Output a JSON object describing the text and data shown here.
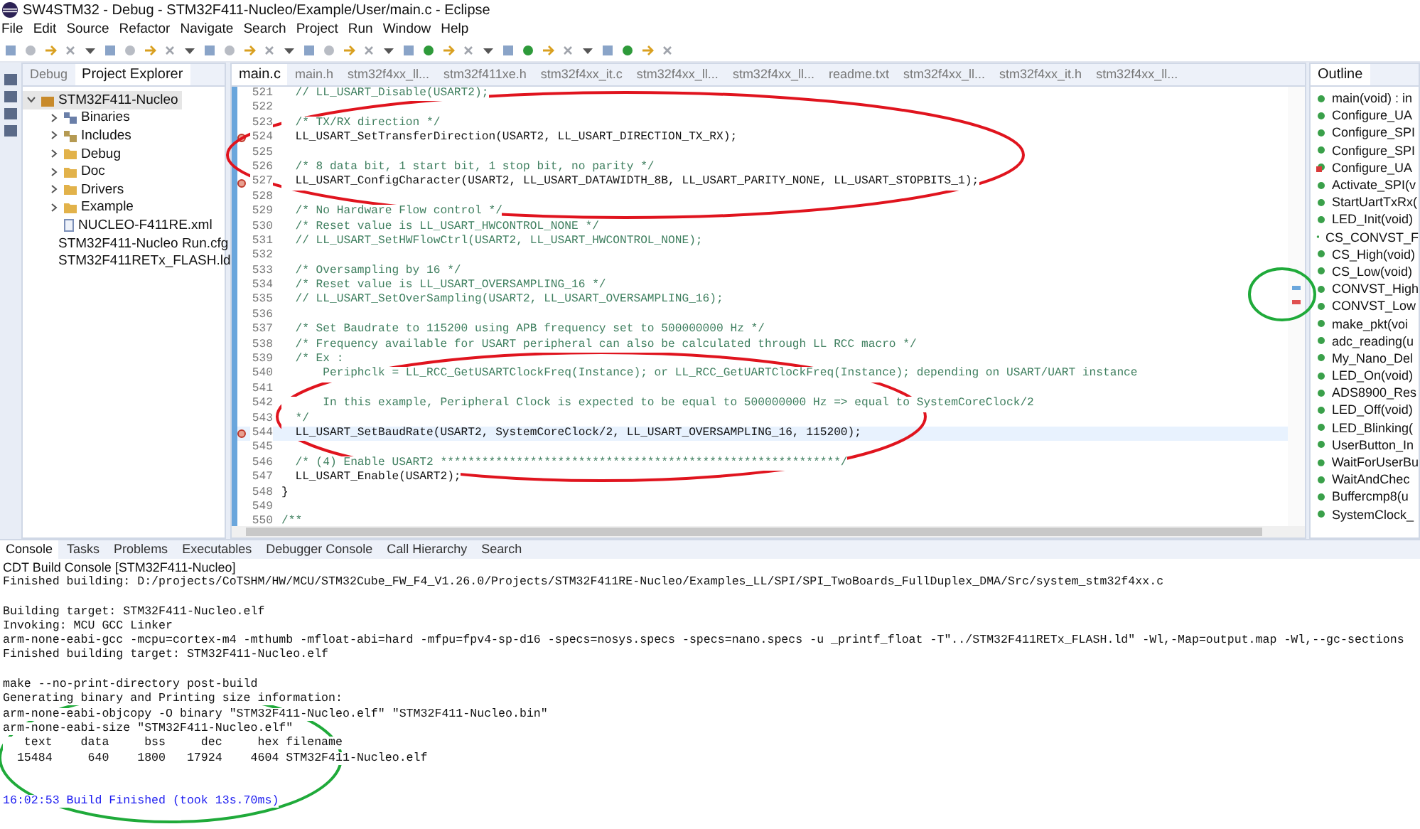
{
  "window": {
    "title": "SW4STM32 - Debug - STM32F411-Nucleo/Example/User/main.c - Eclipse"
  },
  "menu": [
    "File",
    "Edit",
    "Source",
    "Refactor",
    "Navigate",
    "Search",
    "Project",
    "Run",
    "Window",
    "Help"
  ],
  "left_panel": {
    "tabs": [
      {
        "label": "Debug",
        "selected": false
      },
      {
        "label": "Project Explorer",
        "selected": true
      }
    ],
    "tree": [
      {
        "label": "STM32F411-Nucleo",
        "kind": "project",
        "expanded": true,
        "selected": true,
        "children": [
          {
            "label": "Binaries",
            "kind": "binaries",
            "expanded": false,
            "selected": false
          },
          {
            "label": "Includes",
            "kind": "includes",
            "expanded": false,
            "selected": false
          },
          {
            "label": "Debug",
            "kind": "folder",
            "expanded": false,
            "selected": false
          },
          {
            "label": "Doc",
            "kind": "folder",
            "expanded": false,
            "selected": false
          },
          {
            "label": "Drivers",
            "kind": "folder",
            "expanded": false,
            "selected": false
          },
          {
            "label": "Example",
            "kind": "folder",
            "expanded": false,
            "selected": false
          },
          {
            "label": "NUCLEO-F411RE.xml",
            "kind": "file",
            "selected": false
          },
          {
            "label": "STM32F411-Nucleo Run.cfg",
            "kind": "file",
            "selected": false
          },
          {
            "label": "STM32F411RETx_FLASH.ld",
            "kind": "file",
            "selected": false
          }
        ]
      }
    ]
  },
  "editor": {
    "tabs": [
      {
        "label": "main.c",
        "selected": true
      },
      {
        "label": "main.h",
        "selected": false
      },
      {
        "label": "stm32f4xx_ll...",
        "selected": false
      },
      {
        "label": "stm32f411xe.h",
        "selected": false
      },
      {
        "label": "stm32f4xx_it.c",
        "selected": false
      },
      {
        "label": "stm32f4xx_ll...",
        "selected": false
      },
      {
        "label": "stm32f4xx_ll...",
        "selected": false
      },
      {
        "label": "readme.txt",
        "selected": false
      },
      {
        "label": "stm32f4xx_ll...",
        "selected": false
      },
      {
        "label": "stm32f4xx_it.h",
        "selected": false
      },
      {
        "label": "stm32f4xx_ll...",
        "selected": false
      }
    ],
    "lines": [
      {
        "num": "521",
        "text": "  // LL_USART_Disable(USART2);",
        "kind": "comment",
        "current": false,
        "marker": false
      },
      {
        "num": "522",
        "kind": "blank",
        "current": false,
        "marker": false
      },
      {
        "num": "523",
        "text": "  /* TX/RX direction */",
        "kind": "comment",
        "current": false,
        "marker": false
      },
      {
        "num": "524",
        "text": "  LL_USART_SetTransferDirection(USART2, LL_USART_DIRECTION_TX_RX);",
        "kind": "code",
        "current": false,
        "marker": true
      },
      {
        "num": "525",
        "kind": "blank",
        "current": false,
        "marker": false
      },
      {
        "num": "526",
        "text": "  /* 8 data bit, 1 start bit, 1 stop bit, no parity */",
        "kind": "comment",
        "current": false,
        "marker": false
      },
      {
        "num": "527",
        "text": "  LL_USART_ConfigCharacter(USART2, LL_USART_DATAWIDTH_8B, LL_USART_PARITY_NONE, LL_USART_STOPBITS_1);",
        "kind": "code",
        "current": false,
        "marker": true
      },
      {
        "num": "528",
        "kind": "blank",
        "current": false,
        "marker": false
      },
      {
        "num": "529",
        "text": "  /* No Hardware Flow control */",
        "kind": "comment",
        "current": false,
        "marker": false
      },
      {
        "num": "530",
        "text": "  /* Reset value is LL_USART_HWCONTROL_NONE */",
        "kind": "comment",
        "current": false,
        "marker": false
      },
      {
        "num": "531",
        "text": "  // LL_USART_SetHWFlowCtrl(USART2, LL_USART_HWCONTROL_NONE);",
        "kind": "comment",
        "current": false,
        "marker": false
      },
      {
        "num": "532",
        "kind": "blank",
        "current": false,
        "marker": false
      },
      {
        "num": "533",
        "text": "  /* Oversampling by 16 */",
        "kind": "comment",
        "current": false,
        "marker": false
      },
      {
        "num": "534",
        "text": "  /* Reset value is LL_USART_OVERSAMPLING_16 */",
        "kind": "comment",
        "current": false,
        "marker": false
      },
      {
        "num": "535",
        "text": "  // LL_USART_SetOverSampling(USART2, LL_USART_OVERSAMPLING_16);",
        "kind": "comment",
        "current": false,
        "marker": false
      },
      {
        "num": "536",
        "kind": "blank",
        "current": false,
        "marker": false
      },
      {
        "num": "537",
        "text": "  /* Set Baudrate to 115200 using APB frequency set to 500000000 Hz */",
        "kind": "comment",
        "current": false,
        "marker": false
      },
      {
        "num": "538",
        "text": "  /* Frequency available for USART peripheral can also be calculated through LL RCC macro */",
        "kind": "comment",
        "current": false,
        "marker": false
      },
      {
        "num": "539",
        "text": "  /* Ex :",
        "kind": "comment",
        "current": false,
        "marker": false
      },
      {
        "num": "540",
        "text": "      Periphclk = LL_RCC_GetUSARTClockFreq(Instance); or LL_RCC_GetUARTClockFreq(Instance); depending on USART/UART instance",
        "kind": "comment",
        "current": false,
        "marker": false
      },
      {
        "num": "541",
        "kind": "blank",
        "current": false,
        "marker": false
      },
      {
        "num": "542",
        "text": "      In this example, Peripheral Clock is expected to be equal to 500000000 Hz => equal to SystemCoreClock/2",
        "kind": "comment",
        "current": false,
        "marker": false
      },
      {
        "num": "543",
        "text": "  */",
        "kind": "comment",
        "current": false,
        "marker": false
      },
      {
        "num": "544",
        "text": "  LL_USART_SetBaudRate(USART2, SystemCoreClock/2, LL_USART_OVERSAMPLING_16, 115200);",
        "kind": "code",
        "current": true,
        "marker": true
      },
      {
        "num": "545",
        "kind": "blank",
        "current": false,
        "marker": false
      },
      {
        "num": "546",
        "text": "  /* (4) Enable USART2 **********************************************************/",
        "kind": "comment",
        "current": false,
        "marker": false
      },
      {
        "num": "547",
        "text": "  LL_USART_Enable(USART2);",
        "kind": "code",
        "current": false,
        "marker": false
      },
      {
        "num": "548",
        "text": "}",
        "kind": "code",
        "current": false,
        "marker": false
      },
      {
        "num": "549",
        "kind": "blank",
        "current": false,
        "marker": false
      },
      {
        "num": "550",
        "text": "/**",
        "kind": "comment",
        "current": false,
        "marker": false
      }
    ]
  },
  "outline": {
    "tab": "Outline",
    "items": [
      {
        "label": "main(void) : in",
        "kind": "function"
      },
      {
        "label": "Configure_UA",
        "kind": "function"
      },
      {
        "label": "Configure_SPI",
        "kind": "function"
      },
      {
        "label": "Configure_SPI",
        "kind": "function"
      },
      {
        "label": "Configure_UA",
        "kind": "flagged"
      },
      {
        "label": "Activate_SPI(v",
        "kind": "function"
      },
      {
        "label": "StartUartTxRx(",
        "kind": "function"
      },
      {
        "label": "LED_Init(void)",
        "kind": "function"
      },
      {
        "label": "CS_CONVST_F",
        "kind": "function"
      },
      {
        "label": "CS_High(void)",
        "kind": "function"
      },
      {
        "label": "CS_Low(void)",
        "kind": "function"
      },
      {
        "label": "CONVST_High",
        "kind": "function"
      },
      {
        "label": "CONVST_Low",
        "kind": "function"
      },
      {
        "label": "make_pkt(voi",
        "kind": "function"
      },
      {
        "label": "adc_reading(u",
        "kind": "function"
      },
      {
        "label": "My_Nano_Del",
        "kind": "function"
      },
      {
        "label": "LED_On(void)",
        "kind": "function"
      },
      {
        "label": "ADS8900_Res",
        "kind": "function"
      },
      {
        "label": "LED_Off(void)",
        "kind": "function"
      },
      {
        "label": "LED_Blinking(",
        "kind": "function"
      },
      {
        "label": "UserButton_In",
        "kind": "function"
      },
      {
        "label": "WaitForUserBu",
        "kind": "function"
      },
      {
        "label": "WaitAndChec",
        "kind": "function"
      },
      {
        "label": "Buffercmp8(u",
        "kind": "function"
      },
      {
        "label": "SystemClock_",
        "kind": "function"
      }
    ]
  },
  "console": {
    "tabs": [
      {
        "label": "Console",
        "selected": true
      },
      {
        "label": "Tasks",
        "selected": false
      },
      {
        "label": "Problems",
        "selected": false
      },
      {
        "label": "Executables",
        "selected": false
      },
      {
        "label": "Debugger Console",
        "selected": false
      },
      {
        "label": "Call Hierarchy",
        "selected": false
      },
      {
        "label": "Search",
        "selected": false
      }
    ],
    "title": "CDT Build Console [STM32F411-Nucleo]",
    "lines": [
      {
        "text": "Finished building: D:/projects/CoTSHM/HW/MCU/STM32Cube_FW_F4_V1.26.0/Projects/STM32F411RE-Nucleo/Examples_LL/SPI/SPI_TwoBoards_FullDuplex_DMA/Src/system_stm32f4xx.c",
        "kind": "output"
      },
      {
        "kind": "blank"
      },
      {
        "text": "Building target: STM32F411-Nucleo.elf",
        "kind": "output"
      },
      {
        "text": "Invoking: MCU GCC Linker",
        "kind": "output"
      },
      {
        "text": "arm-none-eabi-gcc -mcpu=cortex-m4 -mthumb -mfloat-abi=hard -mfpu=fpv4-sp-d16 -specs=nosys.specs -specs=nano.specs -u _printf_float -T\"../STM32F411RETx_FLASH.ld\" -Wl,-Map=output.map -Wl,--gc-sections",
        "kind": "output"
      },
      {
        "text": "Finished building target: STM32F411-Nucleo.elf",
        "kind": "output"
      },
      {
        "kind": "blank"
      },
      {
        "text": "make --no-print-directory post-build",
        "kind": "output"
      },
      {
        "text": "Generating binary and Printing size information:",
        "kind": "output"
      },
      {
        "text": "arm-none-eabi-objcopy -O binary \"STM32F411-Nucleo.elf\" \"STM32F411-Nucleo.bin\"",
        "kind": "output"
      },
      {
        "text": "arm-none-eabi-size \"STM32F411-Nucleo.elf\"",
        "kind": "output"
      },
      {
        "text": "   text    data     bss     dec     hex filename",
        "kind": "output"
      },
      {
        "text": "  15484     640    1800   17924    4604 STM32F411-Nucleo.elf",
        "kind": "output"
      },
      {
        "kind": "blank"
      },
      {
        "kind": "blank"
      },
      {
        "text": "16:02:53 Build Finished (took 13s.70ms)",
        "kind": "status"
      }
    ]
  },
  "annotations": [
    {
      "color": "#e0141e"
    },
    {
      "color": "#e0141e"
    },
    {
      "color": "#1faa3a"
    },
    {
      "color": "#1faa3a"
    }
  ]
}
